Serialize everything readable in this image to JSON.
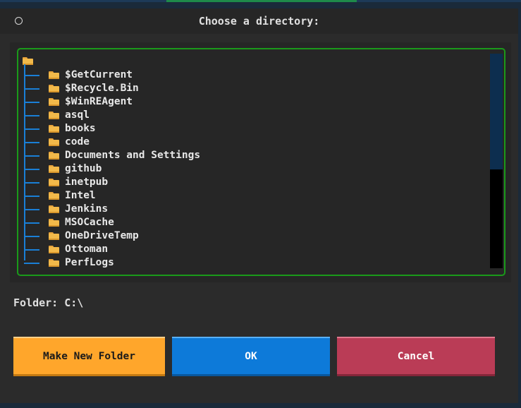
{
  "dialog": {
    "title": "Choose a directory:"
  },
  "tree": {
    "items": [
      {
        "label": "$GetCurrent"
      },
      {
        "label": "$Recycle.Bin"
      },
      {
        "label": "$WinREAgent"
      },
      {
        "label": "asql"
      },
      {
        "label": "books"
      },
      {
        "label": "code"
      },
      {
        "label": "Documents and Settings"
      },
      {
        "label": "github"
      },
      {
        "label": "inetpub"
      },
      {
        "label": "Intel"
      },
      {
        "label": "Jenkins"
      },
      {
        "label": "MSOCache"
      },
      {
        "label": "OneDriveTemp"
      },
      {
        "label": "Ottoman"
      },
      {
        "label": "PerfLogs"
      }
    ]
  },
  "folder": {
    "text": "Folder: C:\\"
  },
  "buttons": {
    "new_folder": "Make New Folder",
    "ok": "OK",
    "cancel": "Cancel"
  },
  "colors": {
    "tree_border": "#1a9a1a",
    "tree_lines": "#1a7fd6",
    "folder_icon": "#f2b94a",
    "new_folder_button": "#ffa62b",
    "ok_button": "#0d7ad9",
    "cancel_button": "#ba3c56"
  },
  "icons": {
    "folder": "folder-icon",
    "window": "circle-icon"
  }
}
